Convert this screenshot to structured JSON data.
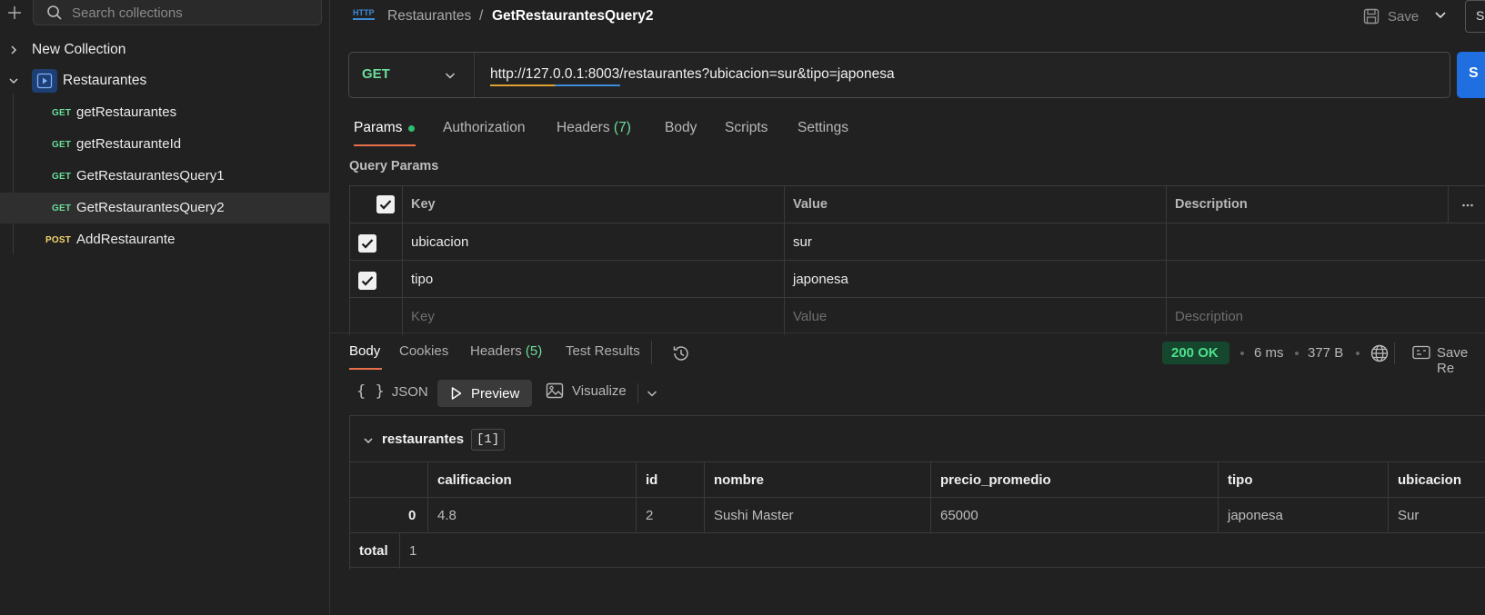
{
  "sidebar": {
    "search_placeholder": "Search collections",
    "collections": [
      {
        "label": "New Collection",
        "expanded": false
      },
      {
        "label": "Restaurantes",
        "expanded": true
      }
    ],
    "requests": [
      {
        "method": "GET",
        "label": "getRestaurantes"
      },
      {
        "method": "GET",
        "label": "getRestauranteId"
      },
      {
        "method": "GET",
        "label": "GetRestaurantesQuery1"
      },
      {
        "method": "GET",
        "label": "GetRestaurantesQuery2",
        "active": true
      },
      {
        "method": "POST",
        "label": "AddRestaurante"
      }
    ]
  },
  "header": {
    "http_badge": "HTTP",
    "breadcrumb_parent": "Restaurantes",
    "breadcrumb_sep": "/",
    "breadcrumb_current": "GetRestaurantesQuery2",
    "save_label": "Save",
    "send_top_label": "S"
  },
  "request": {
    "method": "GET",
    "url": "http://127.0.0.1:8003/restaurantes?ubicacion=sur&tipo=japonesa",
    "send_label": "S",
    "tabs": {
      "params": "Params",
      "authorization": "Authorization",
      "headers": "Headers",
      "headers_count": "(7)",
      "body": "Body",
      "scripts": "Scripts",
      "settings": "Settings"
    },
    "query_params_title": "Query Params",
    "params_table": {
      "headers": {
        "key": "Key",
        "value": "Value",
        "description": "Description"
      },
      "rows": [
        {
          "key": "ubicacion",
          "value": "sur",
          "description": ""
        },
        {
          "key": "tipo",
          "value": "japonesa",
          "description": ""
        }
      ],
      "placeholders": {
        "key": "Key",
        "value": "Value",
        "description": "Description"
      }
    }
  },
  "response": {
    "tabs": {
      "body": "Body",
      "cookies": "Cookies",
      "headers": "Headers",
      "headers_count": "(5)",
      "test_results": "Test Results"
    },
    "status": "200 OK",
    "time": "6 ms",
    "size": "377 B",
    "save_label": "Save Re",
    "formats": {
      "json": "JSON",
      "preview": "Preview",
      "visualize": "Visualize"
    },
    "preview": {
      "root_key": "restaurantes",
      "root_count": "[1]",
      "columns": [
        "calificacion",
        "id",
        "nombre",
        "precio_promedio",
        "tipo",
        "ubicacion"
      ],
      "rows": [
        {
          "index": "0",
          "values": [
            "4.8",
            "2",
            "Sushi Master",
            "65000",
            "japonesa",
            "Sur"
          ]
        }
      ],
      "total_label": "total",
      "total_value": "1"
    }
  },
  "colors": {
    "background": "#212121",
    "get_method": "#6bdd9a",
    "post_method": "#f5d76e",
    "accent_underline": "#e8704a",
    "send_button": "#1f6fe0",
    "status_ok_bg": "#15472e",
    "status_ok_text": "#4fe08c"
  }
}
